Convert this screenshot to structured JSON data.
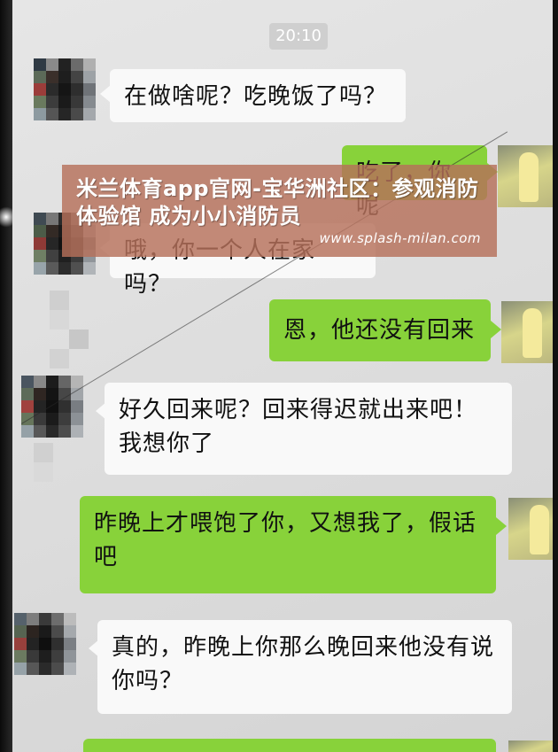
{
  "chat": {
    "timestamp": "20:10",
    "messages": [
      {
        "side": "in",
        "text": "在做啥呢？吃晚饭了吗？"
      },
      {
        "side": "out",
        "text": "吃了，你呢"
      },
      {
        "side": "in",
        "text": "哦，你一个人在家吗？"
      },
      {
        "side": "out",
        "text": "恩，他还没有回来"
      },
      {
        "side": "in",
        "text": "好久回来呢？回来得迟就出来吧！我想你了"
      },
      {
        "side": "out",
        "text": "昨晚上才喂饱了你，又想我了，假话吧"
      },
      {
        "side": "in",
        "text": "真的，昨晚上你那么晚回来他没有说你吗？"
      }
    ]
  },
  "overlay": {
    "title": "米兰体育app官网-宝华洲社区：参观消防体验馆 成为小小消防员",
    "url": "www.splash-milan.com"
  },
  "colors": {
    "incoming_bubble": "#f9f9f9",
    "outgoing_bubble": "#88d23a",
    "overlay_bg": "#b6705a",
    "chat_bg": "#e2e2e2"
  }
}
